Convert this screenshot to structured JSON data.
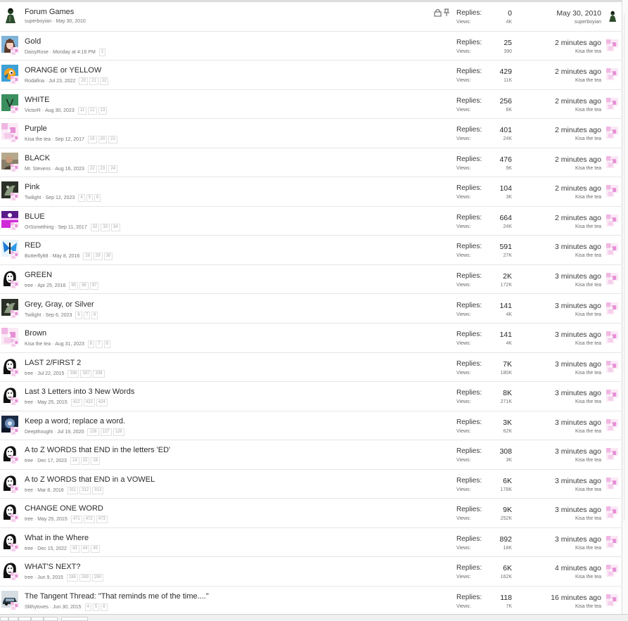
{
  "labels": {
    "replies": "Replies:",
    "views": "Views:"
  },
  "threads": [
    {
      "title": "Forum Games",
      "author": "superboyian",
      "date": "May 30, 2010",
      "pages": [],
      "replies": "0",
      "views": "4K",
      "last_time": "May 30, 2010",
      "last_user": "superboyian",
      "avatar": "man-avatar",
      "pinned": true
    },
    {
      "title": "Gold",
      "author": "DaisyRose",
      "date": "Monday at 4:16 PM",
      "pages": [
        "2"
      ],
      "replies": "25",
      "views": "390",
      "last_time": "2 minutes ago",
      "last_user": "Kisa the tea",
      "avatar": "anime-avatar"
    },
    {
      "title": "ORANGE or YELLOW",
      "author": "Rodafina",
      "date": "Jul 23, 2022",
      "pages": [
        "20",
        "21",
        "22"
      ],
      "replies": "429",
      "views": "11K",
      "last_time": "2 minutes ago",
      "last_user": "Kisa the tea",
      "avatar": "bird-avatar"
    },
    {
      "title": "WHITE",
      "author": "VictorR",
      "date": "Aug 30, 2023",
      "pages": [
        "11",
        "12",
        "13"
      ],
      "replies": "256",
      "views": "6K",
      "last_time": "2 minutes ago",
      "last_user": "Kisa the tea",
      "avatar": "letter-v-avatar",
      "avatar_letter": "V"
    },
    {
      "title": "Purple",
      "author": "Kisa the tea",
      "date": "Sep 12, 2017",
      "pages": [
        "19",
        "20",
        "21"
      ],
      "replies": "401",
      "views": "24K",
      "last_time": "2 minutes ago",
      "last_user": "Kisa the tea",
      "avatar": "pink-avatar"
    },
    {
      "title": "BLACK",
      "author": "Mr. Stevens",
      "date": "Aug 16, 2023",
      "pages": [
        "22",
        "23",
        "24"
      ],
      "replies": "476",
      "views": "9K",
      "last_time": "2 minutes ago",
      "last_user": "Kisa the tea",
      "avatar": "photo-avatar"
    },
    {
      "title": "Pink",
      "author": "Twilight",
      "date": "Sep 12, 2023",
      "pages": [
        "4",
        "5",
        "6"
      ],
      "replies": "104",
      "views": "3K",
      "last_time": "2 minutes ago",
      "last_user": "Kisa the tea",
      "avatar": "dark-avatar"
    },
    {
      "title": "BLUE",
      "author": "OrSomething",
      "date": "Sep 11, 2017",
      "pages": [
        "32",
        "33",
        "34"
      ],
      "replies": "664",
      "views": "24K",
      "last_time": "2 minutes ago",
      "last_user": "Kisa the tea",
      "avatar": "purple-avatar"
    },
    {
      "title": "RED",
      "author": "Butterfly88",
      "date": "May 8, 2016",
      "pages": [
        "28",
        "29",
        "30"
      ],
      "replies": "591",
      "views": "27K",
      "last_time": "3 minutes ago",
      "last_user": "Kisa the tea",
      "avatar": "butterfly-avatar"
    },
    {
      "title": "GREEN",
      "author": "tree",
      "date": "Apr 25, 2016",
      "pages": [
        "95",
        "96",
        "97"
      ],
      "replies": "2K",
      "views": "172K",
      "last_time": "3 minutes ago",
      "last_user": "Kisa the tea",
      "avatar": "face-avatar"
    },
    {
      "title": "Grey, Gray, or Silver",
      "author": "Twilight",
      "date": "Sep 6, 2023",
      "pages": [
        "6",
        "7",
        "8"
      ],
      "replies": "141",
      "views": "4K",
      "last_time": "3 minutes ago",
      "last_user": "Kisa the tea",
      "avatar": "dark-avatar"
    },
    {
      "title": "Brown",
      "author": "Kisa the tea",
      "date": "Aug 31, 2023",
      "pages": [
        "6",
        "7",
        "8"
      ],
      "replies": "141",
      "views": "4K",
      "last_time": "3 minutes ago",
      "last_user": "Kisa the tea",
      "avatar": "pink-avatar"
    },
    {
      "title": "LAST 2/FIRST 2",
      "author": "tree",
      "date": "Jul 22, 2015",
      "pages": [
        "336",
        "337",
        "338"
      ],
      "replies": "7K",
      "views": "180K",
      "last_time": "3 minutes ago",
      "last_user": "Kisa the tea",
      "avatar": "face-avatar"
    },
    {
      "title": "Last 3 Letters into 3 New Words",
      "author": "tree",
      "date": "May 25, 2015",
      "pages": [
        "422",
        "423",
        "424"
      ],
      "replies": "8K",
      "views": "271K",
      "last_time": "3 minutes ago",
      "last_user": "Kisa the tea",
      "avatar": "face-avatar"
    },
    {
      "title": "Keep a word; replace a word.",
      "author": "Deepthought",
      "date": "Jul 19, 2020",
      "pages": [
        "126",
        "127",
        "128"
      ],
      "replies": "3K",
      "views": "62K",
      "last_time": "3 minutes ago",
      "last_user": "Kisa the tea",
      "avatar": "space-avatar"
    },
    {
      "title": "A to Z WORDS that END in the letters 'ED'",
      "author": "tree",
      "date": "Dec 17, 2023",
      "pages": [
        "14",
        "15",
        "16"
      ],
      "replies": "308",
      "views": "3K",
      "last_time": "3 minutes ago",
      "last_user": "Kisa the tea",
      "avatar": "face-avatar"
    },
    {
      "title": "A to Z WORDS that END in a VOWEL",
      "author": "tree",
      "date": "Mar 8, 2016",
      "pages": [
        "311",
        "312",
        "313"
      ],
      "replies": "6K",
      "views": "178K",
      "last_time": "3 minutes ago",
      "last_user": "Kisa the tea",
      "avatar": "face-avatar"
    },
    {
      "title": "CHANGE ONE WORD",
      "author": "tree",
      "date": "May 25, 2015",
      "pages": [
        "471",
        "472",
        "473"
      ],
      "replies": "9K",
      "views": "252K",
      "last_time": "3 minutes ago",
      "last_user": "Kisa the tea",
      "avatar": "face-avatar"
    },
    {
      "title": "What in the Where",
      "author": "tree",
      "date": "Dec 15, 2022",
      "pages": [
        "43",
        "44",
        "45"
      ],
      "replies": "892",
      "views": "18K",
      "last_time": "3 minutes ago",
      "last_user": "Kisa the tea",
      "avatar": "face-avatar"
    },
    {
      "title": "WHAT'S NEXT?",
      "author": "tree",
      "date": "Jun 9, 2015",
      "pages": [
        "288",
        "289",
        "290"
      ],
      "replies": "6K",
      "views": "162K",
      "last_time": "4 minutes ago",
      "last_user": "Kisa the tea",
      "avatar": "face-avatar"
    },
    {
      "title": "The Tangent Thread: \"That reminds me of the time....\"",
      "author": "Slithytoves",
      "date": "Jun 30, 2015",
      "pages": [
        "4",
        "5",
        "6"
      ],
      "replies": "118",
      "views": "7K",
      "last_time": "16 minutes ago",
      "last_user": "Kisa the tea",
      "avatar": "car-avatar"
    }
  ]
}
